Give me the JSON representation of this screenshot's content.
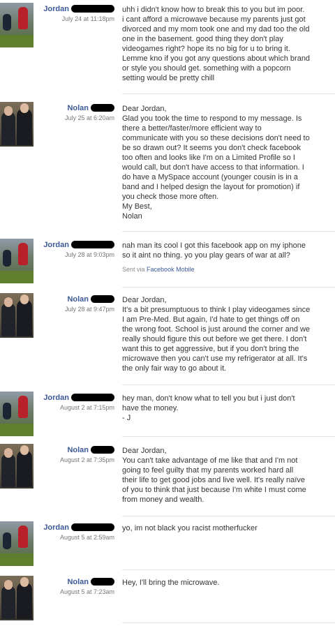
{
  "messages": [
    {
      "sender": "Jordan",
      "time": "July 24 at 11:18pm",
      "lines": [
        "uhh i didn't know how to break this to you but im poor.",
        "i cant afford a microwave because my parents just got",
        "divorced and my mom took one and my dad too the old",
        "one in the basement. good thing they don't play",
        "videogames right? hope its no big for u to bring it.",
        "Lemme kno if you got any questions about which brand",
        "or style you should get. something with a popcorn",
        "setting would be pretty chill"
      ]
    },
    {
      "sender": "Nolan",
      "time": "July 25 at 6:20am",
      "lines": [
        "Dear Jordan,",
        "Glad you took the time to respond to my message. Is",
        "there a better/faster/more efficient way to",
        "communicate with you so these decisions don't need to",
        "be so drawn out? It seems you don't check facebook",
        "too often and looks like I'm on a Limited Profile so I",
        "would call, but don't have access to that information. I",
        "do have a MySpace account (younger cousin is in a",
        "band and I helped design the layout for promotion) if",
        "you check those more often.",
        "My Best,",
        "Nolan"
      ]
    },
    {
      "sender": "Jordan",
      "time": "July 28 at 9:03pm",
      "lines": [
        "nah man its cool I got this facebook app on my iphone",
        "so it aint no thing. yo you play gears of war at all?"
      ],
      "via_prefix": "Sent via",
      "via_link": "Facebook Mobile"
    },
    {
      "sender": "Nolan",
      "time": "July 28 at 9:47pm",
      "lines": [
        "Dear Jordan,",
        "It's a bit presumptuous to think I play videogames since",
        "I am Pre-Med. But again, I'd hate to get things off on",
        "the wrong foot. School is just around the corner and we",
        "really should figure this out before we get there. I don't",
        "want this to get aggressive, but if you don't bring the",
        "microwave then you can't use my refrigerator at all. It's",
        "the only fair way to go about it."
      ]
    },
    {
      "sender": "Jordan",
      "time": "August 2 at 7:15pm",
      "lines": [
        "hey man, don't know what to tell you but i just don't",
        "have the money.",
        "- J"
      ]
    },
    {
      "sender": "Nolan",
      "time": "August 2 at 7:35pm",
      "lines": [
        "Dear Jordan,",
        "You can't take advantage of me like that and I'm not",
        "going to feel guilty that my parents worked hard all",
        "their life to get good jobs and live well. It's really naïve",
        "of you to think that just because I'm white I must come",
        "from money and wealth."
      ]
    },
    {
      "sender": "Jordan",
      "time": "August 5 at 2:59am",
      "lines": [
        "yo, im not black you racist motherfucker"
      ]
    },
    {
      "sender": "Nolan",
      "time": "August 5 at 7:23am",
      "lines": [
        "Hey, I'll bring the microwave."
      ]
    }
  ]
}
